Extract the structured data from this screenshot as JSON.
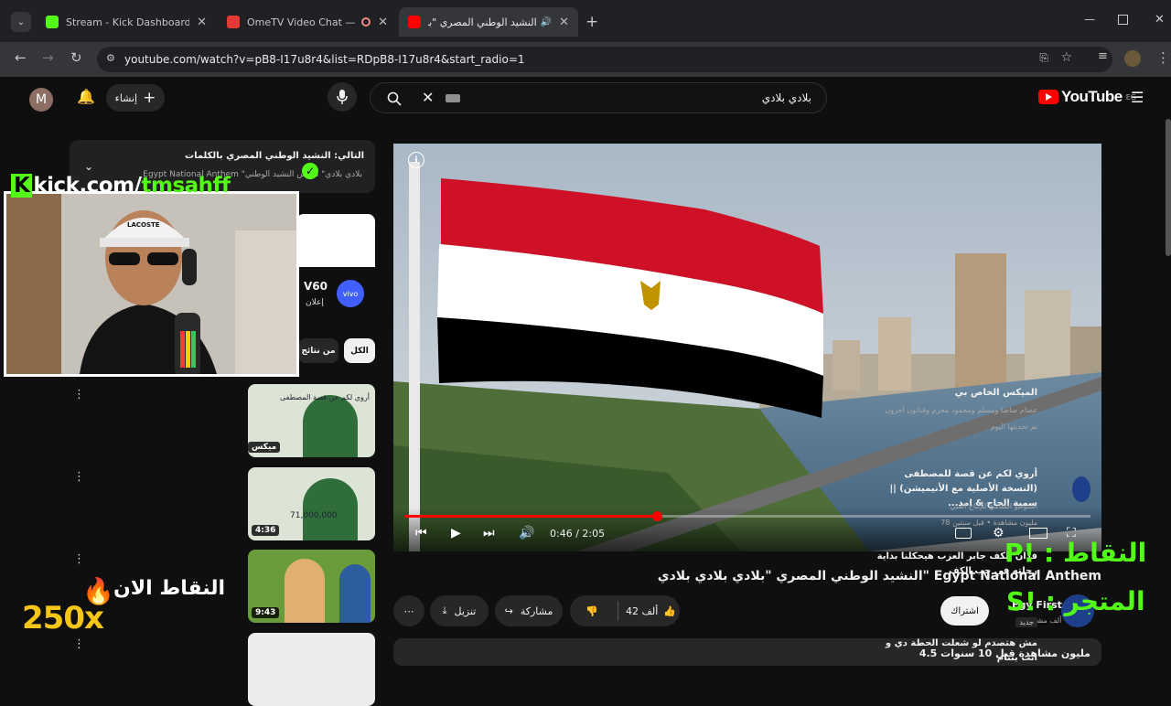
{
  "browser": {
    "tabs": [
      {
        "label": "Stream - Kick Dashboard",
        "icon": "kick-icon",
        "color": "#53fc18"
      },
      {
        "label": "OmeTV Video Chat — Ome",
        "icon": "ometv-icon",
        "color": "#e53935"
      },
      {
        "label": "النشيد الوطني المصري \"بلادي",
        "icon": "youtube-icon",
        "color": "#ff0000"
      }
    ],
    "url": "youtube.com/watch?v=pB8-I17u8r4&list=RDpB8-I17u8r4&start_radio=1"
  },
  "youtube": {
    "avatar_letter": "M",
    "create_label": "إنشاء",
    "search_query": "بلادي بلادي",
    "logo_text": "YouTube",
    "region": "EG"
  },
  "player": {
    "time_current": "0:46",
    "time_total": "2:05",
    "progress_fraction": 0.368,
    "flag_colors": [
      "#ce1126",
      "#ffffff",
      "#000000"
    ]
  },
  "video": {
    "title": "النشيد الوطني المصري \"بلادي بلادي بلادي\" Egypt National Anthem",
    "like_count": "42 ألف",
    "share_label": "مشاركة",
    "download_label": "تنزيل",
    "subscribe_label": "اشتراك",
    "channel_short": "Egy First",
    "subs_short": "ألف مشترك",
    "views_line": "4.5 مليون مشاهدة قبل 10 سنوات"
  },
  "sidebar": {
    "upnext_title": "التالي: النشيد الوطني المصري بالكلمات",
    "upnext_sub": "Egypt National Anthem \"بلادي بلادي\" ميكس النشيد الوطني",
    "ad_title": "V60",
    "ad_label": "إعلان",
    "ad_brand": "vivo",
    "chips": [
      "الكل",
      "من نتائج"
    ],
    "videos": [
      {
        "title": "الميكس الخاص بي",
        "meta1": "عصام صاصا ومسلم ومحمود محرم وفنانون آخرون",
        "meta2": "تم تحديثها اليوم",
        "badge": "ميكس",
        "thumb_text": "أروي لكم عن قصة المصطفى"
      },
      {
        "title": "أروي لكم عن قصة للمصطفى (النسخة الأصلية مع الأنيميشن) || سمية الحاج & امد...",
        "meta1": "استوديو الشامي للإنتاج الفني",
        "meta2": "78 مليون مشاهدة • قبل سنتين",
        "badge": "4:36",
        "thumb_text": "71,000,000"
      },
      {
        "title": "فدان الكف جابر العزب هيحكلنا بداية رحلته في حب الكف",
        "meta1": "",
        "meta2": "جديد",
        "badge": "9:43",
        "thumb_text": ""
      },
      {
        "title": "مش هتصدم لو شعلت الحطة دي و انت بتنام",
        "meta1": "",
        "meta2": "",
        "badge": "",
        "thumb_text": ""
      }
    ]
  },
  "stream_overlay": {
    "kick_k": "K",
    "kick_domain": "kick.com/",
    "kick_user": "tmsahff",
    "points_now": "النقاط الان",
    "points_value": "250x",
    "points_cmd": "النقاط : !P",
    "store_cmd": "المتجر : !S",
    "cap_text": "LACOSTE"
  }
}
